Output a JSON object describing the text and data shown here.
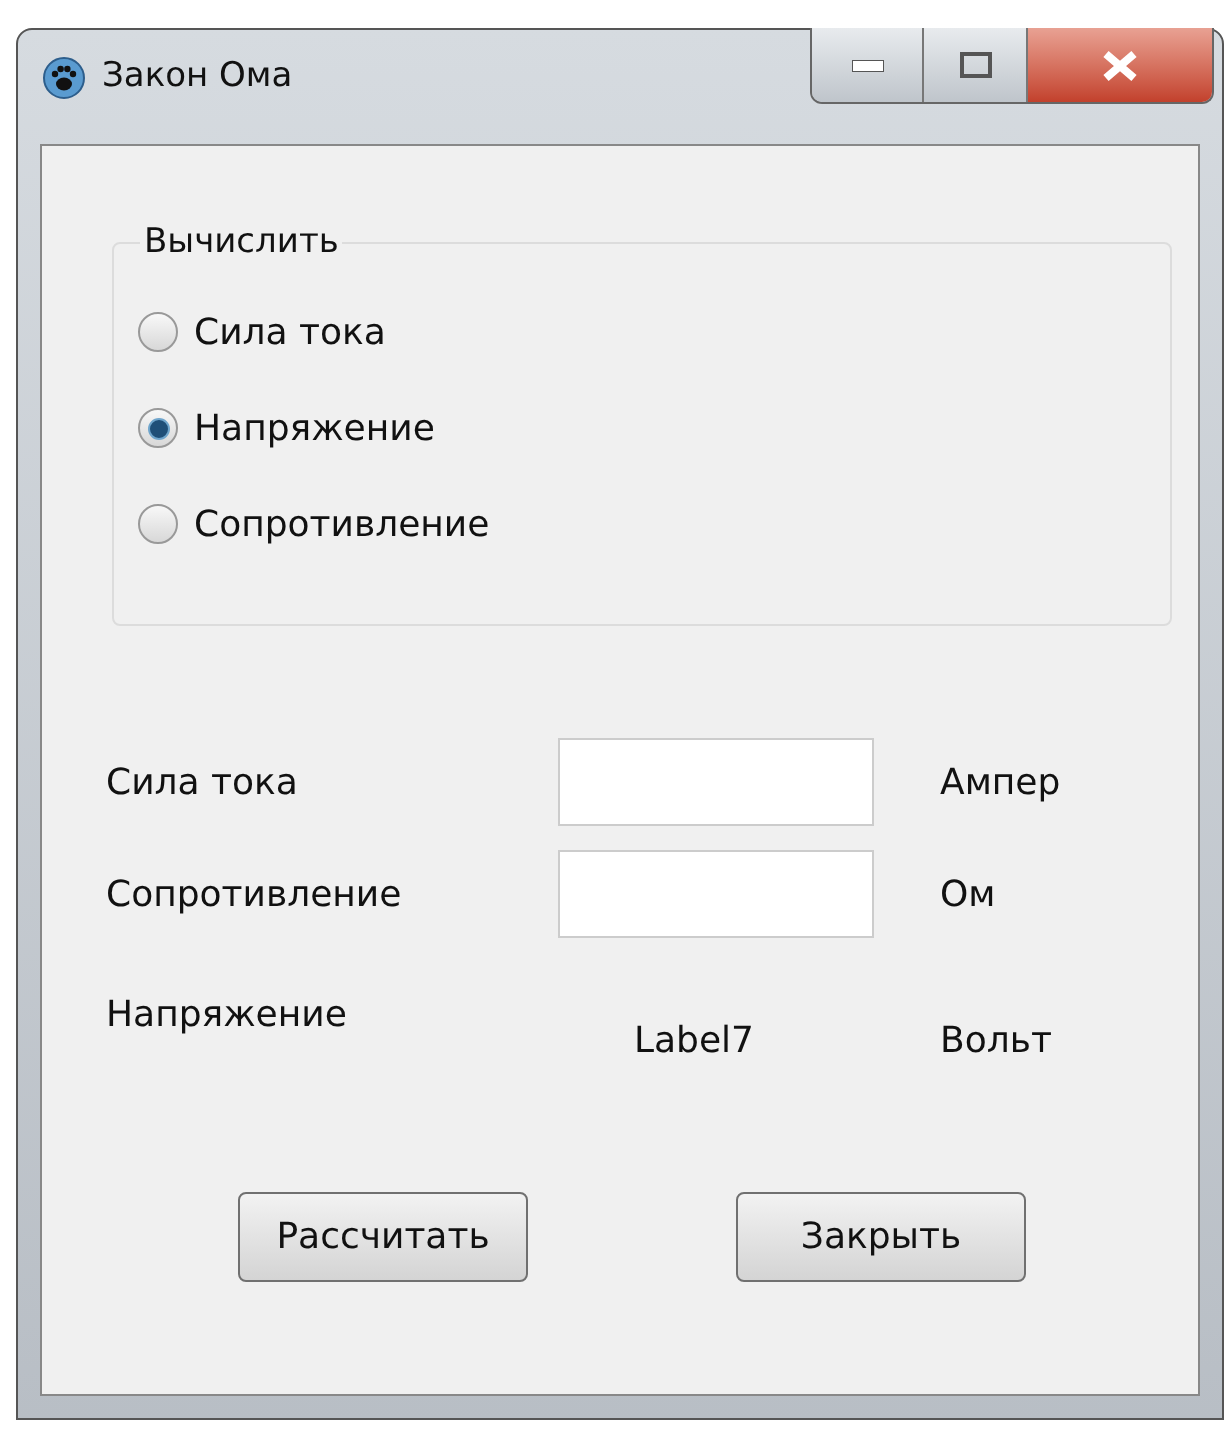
{
  "window": {
    "title": "Закон Ома"
  },
  "group": {
    "title": "Вычислить",
    "options": [
      {
        "label": "Сила тока",
        "selected": false
      },
      {
        "label": "Напряжение",
        "selected": true
      },
      {
        "label": "Сопротивление",
        "selected": false
      }
    ]
  },
  "rows": [
    {
      "kind": "input",
      "label": "Сила тока",
      "unit": "Ампер"
    },
    {
      "kind": "input",
      "label": "Сопротивление",
      "unit": "Ом"
    },
    {
      "kind": "output",
      "label": "Напряжение",
      "value": "Label7",
      "unit": "Вольт"
    }
  ],
  "buttons": [
    "Рассчитать",
    "Закрыть"
  ]
}
